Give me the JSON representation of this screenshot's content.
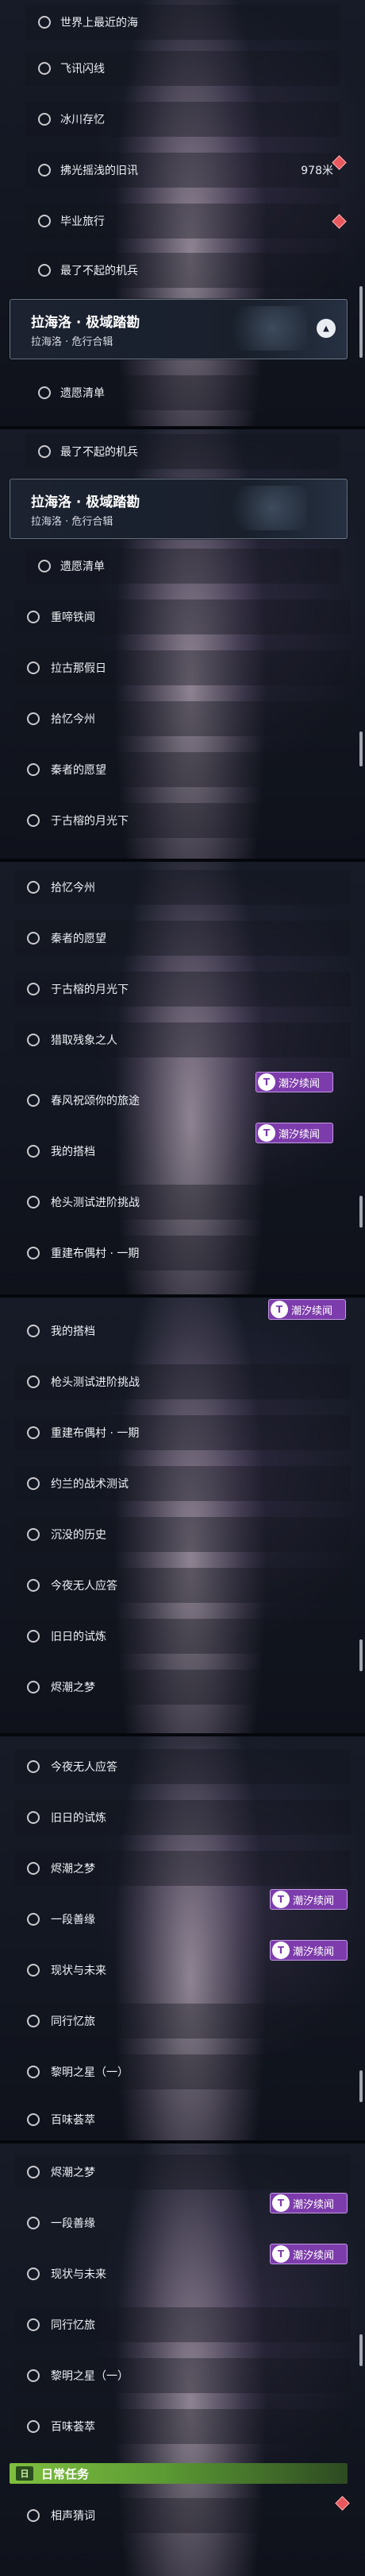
{
  "colors": {
    "badge_bg": "#7d3cab",
    "marker": "#e8585e",
    "daily_bar": "#6aa93a"
  },
  "icons": {
    "task_marker": "circle-outline-icon",
    "alert": "red-diamond-icon",
    "badge": "tide-badge-icon",
    "collapse": "chevron-up-icon",
    "daily": "calendar-icon"
  },
  "badge_label": "潮汐续闻",
  "badge_icon_glyph": "T",
  "collapse_glyph": "▲",
  "daily_icon_glyph": "日",
  "header": {
    "title": "拉海洛 · 极域踏勘",
    "subtitle": "拉海洛 · 危行合辑"
  },
  "daily": {
    "label": "日常任务"
  },
  "seg1": {
    "items": [
      {
        "label": "世界上最近的海"
      },
      {
        "label": "飞讯闪线"
      },
      {
        "label": "冰川存忆"
      },
      {
        "label": "拂光摇浅的旧讯",
        "distance": "978米"
      },
      {
        "label": "毕业旅行"
      },
      {
        "label": "最了不起的机兵"
      },
      {
        "label": "遗愿清单"
      }
    ]
  },
  "seg2": {
    "items": [
      {
        "label": "最了不起的机兵"
      },
      {
        "label": "遗愿清单"
      },
      {
        "label": "重啼铁闻"
      },
      {
        "label": "拉古那假日"
      },
      {
        "label": "拾忆今州"
      },
      {
        "label": "秦者的愿望"
      },
      {
        "label": "于古榕的月光下"
      }
    ]
  },
  "seg3": {
    "items": [
      {
        "label": "拾忆今州"
      },
      {
        "label": "秦者的愿望"
      },
      {
        "label": "于古榕的月光下"
      },
      {
        "label": "猎取残象之人"
      },
      {
        "label": "春风祝颂你的旅途"
      },
      {
        "label": "我的搭档"
      },
      {
        "label": "枪头测试进阶挑战"
      },
      {
        "label": "重建布偶村 · 一期"
      }
    ]
  },
  "seg4": {
    "items": [
      {
        "label": "我的搭档"
      },
      {
        "label": "枪头测试进阶挑战"
      },
      {
        "label": "重建布偶村 · 一期"
      },
      {
        "label": "约兰的战术测试"
      },
      {
        "label": "沉没的历史"
      },
      {
        "label": "今夜无人应答"
      },
      {
        "label": "旧日的试炼"
      },
      {
        "label": "烬潮之梦"
      }
    ]
  },
  "seg5": {
    "items": [
      {
        "label": "今夜无人应答"
      },
      {
        "label": "旧日的试炼"
      },
      {
        "label": "烬潮之梦"
      },
      {
        "label": "一段善缘"
      },
      {
        "label": "现状与未来"
      },
      {
        "label": "同行忆旅"
      },
      {
        "label": "黎明之星（一）"
      },
      {
        "label": "百味荟萃"
      }
    ]
  },
  "seg6": {
    "items": [
      {
        "label": "烬潮之梦"
      },
      {
        "label": "一段善缘"
      },
      {
        "label": "现状与未来"
      },
      {
        "label": "同行忆旅"
      },
      {
        "label": "黎明之星（一）"
      },
      {
        "label": "百味荟萃"
      },
      {
        "label": "相声猜词"
      }
    ]
  }
}
